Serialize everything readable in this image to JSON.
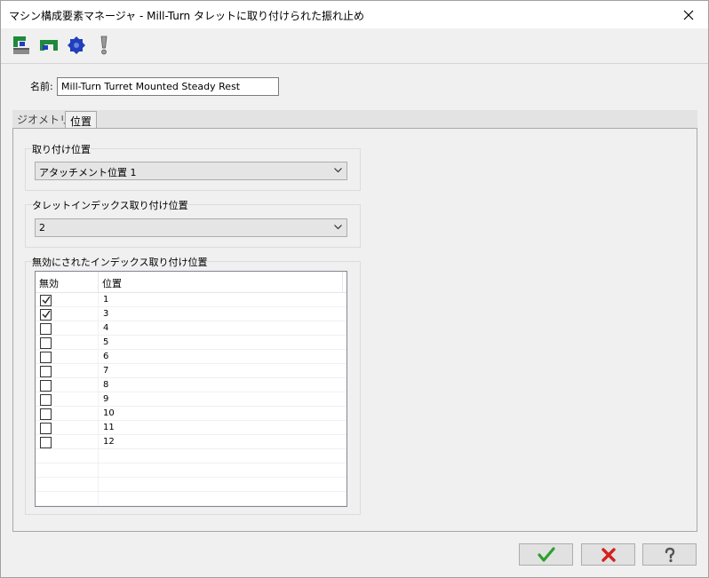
{
  "window": {
    "title": "マシン構成要素マネージャ - Mill-Turn タレットに取り付けられた振れ止め"
  },
  "toolbar": {
    "icons": [
      "turret-geometry-icon",
      "mount-icon",
      "gear-icon",
      "warning-icon"
    ]
  },
  "name_field": {
    "label": "名前:",
    "value": "Mill-Turn Turret Mounted Steady Rest"
  },
  "tabs": [
    {
      "label": "ジオメトリ",
      "active": false
    },
    {
      "label": "位置",
      "active": true
    }
  ],
  "mount_position": {
    "label": "取り付け位置",
    "selected": "アタッチメント位置 1"
  },
  "turret_index": {
    "label": "タレットインデックス取り付け位置",
    "selected": "2"
  },
  "disabled_indexes": {
    "label": "無効にされたインデックス取り付け位置",
    "columns": [
      "無効",
      "位置"
    ],
    "rows": [
      {
        "disabled": true,
        "position": "1"
      },
      {
        "disabled": true,
        "position": "3"
      },
      {
        "disabled": false,
        "position": "4"
      },
      {
        "disabled": false,
        "position": "5"
      },
      {
        "disabled": false,
        "position": "6"
      },
      {
        "disabled": false,
        "position": "7"
      },
      {
        "disabled": false,
        "position": "8"
      },
      {
        "disabled": false,
        "position": "9"
      },
      {
        "disabled": false,
        "position": "10"
      },
      {
        "disabled": false,
        "position": "11"
      },
      {
        "disabled": false,
        "position": "12"
      }
    ]
  },
  "buttons": {
    "ok": "ok-check-icon",
    "cancel": "cancel-x-icon",
    "help": "help-question-icon"
  },
  "colors": {
    "ok_green": "#2e9e2e",
    "cancel_red": "#d42020",
    "toolbar_blue": "#1f3fbf",
    "toolbar_green": "#1e8a3c"
  }
}
